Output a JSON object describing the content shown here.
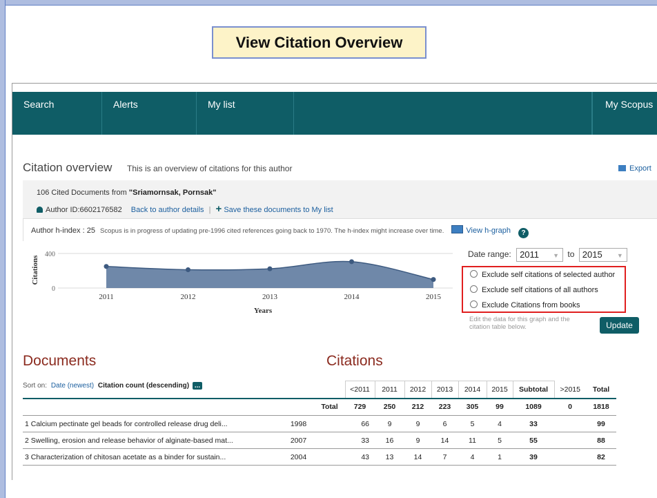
{
  "slide_title": "View Citation Overview",
  "nav": {
    "items": [
      "Search",
      "Alerts",
      "My list",
      "",
      "My Scopus"
    ]
  },
  "overview": {
    "title": "Citation overview",
    "subtitle": "This is an overview of citations for this author",
    "export_label": "Export"
  },
  "info": {
    "cited_prefix": "106 Cited Documents from ",
    "author_name": "\"Sriamornsak, Pornsak\"",
    "author_id": "Author ID:6602176582",
    "back_link": "Back to author details",
    "save_link": "Save these documents to My list",
    "hindex_label": "Author h-index : 25",
    "hindex_note": "Scopus is in progress of updating pre-1996 cited references going back to 1970. The h-index might increase over time.",
    "view_hgraph": "View h-graph"
  },
  "chart_data": {
    "type": "area",
    "x": [
      2011,
      2012,
      2013,
      2014,
      2015
    ],
    "y": [
      250,
      212,
      223,
      305,
      99
    ],
    "xlabel": "Years",
    "ylabel": "Citations",
    "yticks": [
      0,
      400
    ],
    "ylim": [
      0,
      400
    ],
    "color": "#56739a"
  },
  "date_range": {
    "label": "Date range:",
    "from": "2011",
    "to_label": "to",
    "to": "2015"
  },
  "exclude_options": [
    "Exclude self citations of selected author",
    "Exclude self citations of all authors",
    "Exclude Citations from books"
  ],
  "edit_note": "Edit the data for this graph and the citation table below.",
  "update_label": "Update",
  "documents_heading": "Documents",
  "citations_heading": "Citations",
  "sort": {
    "prefix": "Sort on:",
    "date": "Date (newest)",
    "count": "Citation count (descending)",
    "more": "..."
  },
  "table": {
    "year_headers": [
      "<2011",
      "2011",
      "2012",
      "2013",
      "2014",
      "2015",
      "Subtotal",
      ">2015",
      "Total"
    ],
    "total_row": {
      "label": "Total",
      "values": [
        "729",
        "250",
        "212",
        "223",
        "305",
        "99",
        "1089",
        "0",
        "1818"
      ]
    },
    "rows": [
      {
        "title": "1  Calcium pectinate gel beads for controlled release drug deli...",
        "year": "1998",
        "values": [
          "66",
          "9",
          "9",
          "6",
          "5",
          "4",
          "33",
          "",
          "99"
        ]
      },
      {
        "title": "2  Swelling, erosion and release behavior of alginate-based mat...",
        "year": "2007",
        "values": [
          "33",
          "16",
          "9",
          "14",
          "11",
          "5",
          "55",
          "",
          "88"
        ]
      },
      {
        "title": "3  Characterization of chitosan acetate as a binder for sustain...",
        "year": "2004",
        "values": [
          "43",
          "13",
          "14",
          "7",
          "4",
          "1",
          "39",
          "",
          "82"
        ]
      }
    ]
  }
}
